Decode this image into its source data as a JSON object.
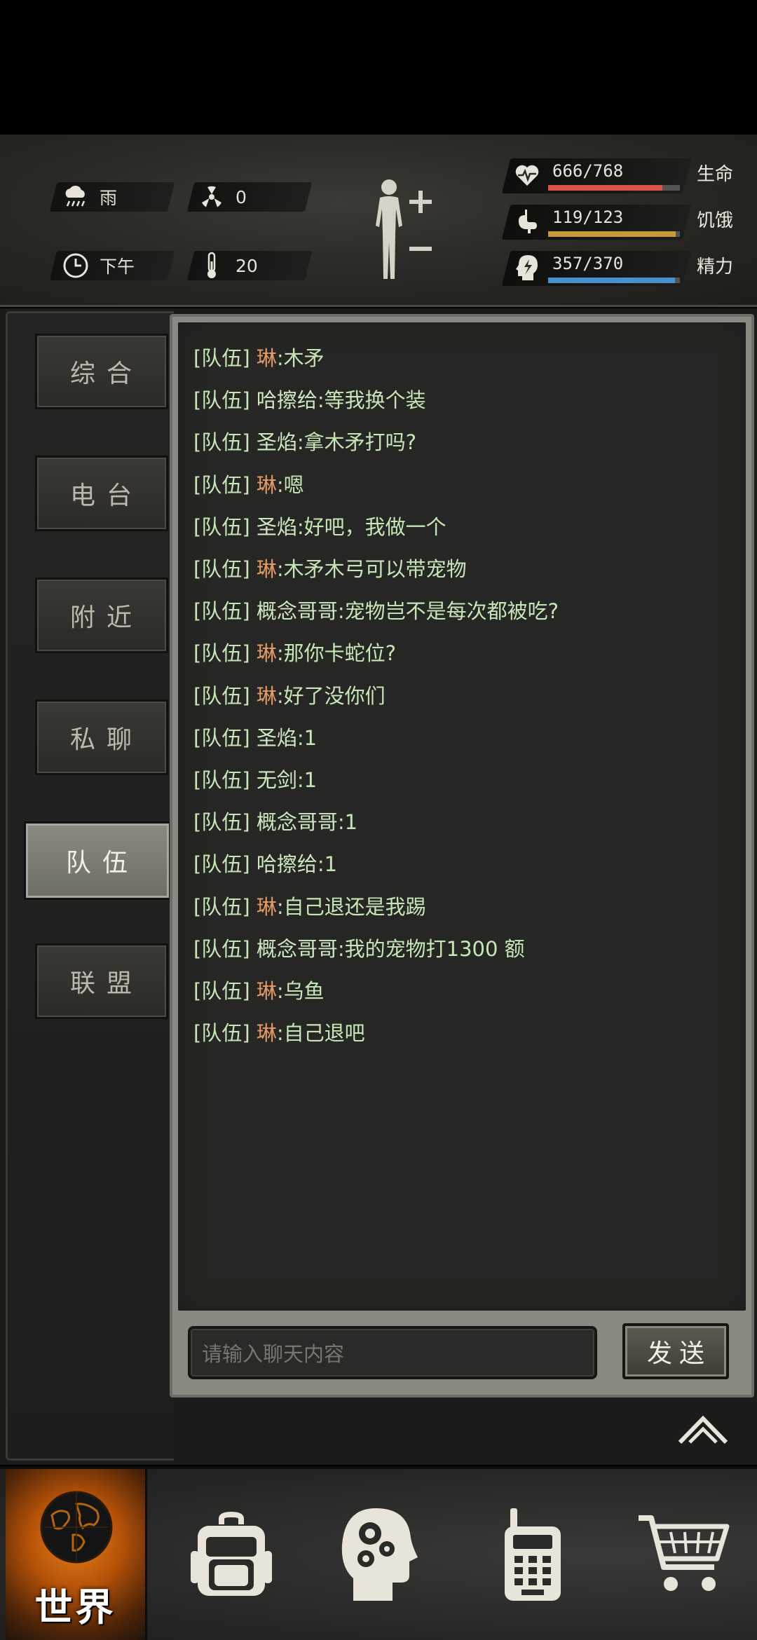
{
  "status": {
    "weather": {
      "icon": "rain-cloud-icon",
      "label": "雨"
    },
    "radiation": {
      "icon": "radiation-icon",
      "value": "0"
    },
    "time": {
      "icon": "clock-icon",
      "label": "下午"
    },
    "temperature": {
      "icon": "thermometer-icon",
      "value": "20"
    },
    "body_button": {
      "icon": "body-figure-icon"
    },
    "stats": [
      {
        "key": "health",
        "icon": "heart-pulse-icon",
        "value": "666/768",
        "label": "生命",
        "fraction": 0.867,
        "color": "#d9544a"
      },
      {
        "key": "hunger",
        "icon": "stomach-icon",
        "value": "119/123",
        "label": "饥饿",
        "fraction": 0.967,
        "color": "#c7993e"
      },
      {
        "key": "energy",
        "icon": "head-lightning-icon",
        "value": "357/370",
        "label": "精力",
        "fraction": 0.965,
        "color": "#4c8fcf"
      }
    ]
  },
  "tabs": [
    {
      "label": "综合",
      "active": false
    },
    {
      "label": "电台",
      "active": false
    },
    {
      "label": "附近",
      "active": false
    },
    {
      "label": "私聊",
      "active": false
    },
    {
      "label": "队伍",
      "active": true
    },
    {
      "label": "联盟",
      "active": false
    }
  ],
  "chat": {
    "messages": [
      {
        "channel": "[队伍]",
        "name": "琳",
        "text": ":木矛",
        "highlight": true
      },
      {
        "channel": "[队伍]",
        "name": "哈擦给",
        "text": ":等我换个装",
        "highlight": false
      },
      {
        "channel": "[队伍]",
        "name": "圣焰",
        "text": ":拿木矛打吗?",
        "highlight": false
      },
      {
        "channel": "[队伍]",
        "name": "琳",
        "text": ":嗯",
        "highlight": true
      },
      {
        "channel": "[队伍]",
        "name": "圣焰",
        "text": ":好吧，我做一个",
        "highlight": false
      },
      {
        "channel": "[队伍]",
        "name": "琳",
        "text": ":木矛木弓可以带宠物",
        "highlight": true
      },
      {
        "channel": "[队伍]",
        "name": "概念哥哥",
        "text": ":宠物岂不是每次都被吃?",
        "highlight": false
      },
      {
        "channel": "[队伍]",
        "name": "琳",
        "text": ":那你卡蛇位?",
        "highlight": true
      },
      {
        "channel": "[队伍]",
        "name": "琳",
        "text": ":好了没你们",
        "highlight": true
      },
      {
        "channel": "[队伍]",
        "name": "圣焰",
        "text": ":1",
        "highlight": false
      },
      {
        "channel": "[队伍]",
        "name": "无剑",
        "text": ":1",
        "highlight": false
      },
      {
        "channel": "[队伍]",
        "name": "概念哥哥",
        "text": ":1",
        "highlight": false
      },
      {
        "channel": "[队伍]",
        "name": "哈擦给",
        "text": ":1",
        "highlight": false
      },
      {
        "channel": "[队伍]",
        "name": "琳",
        "text": ":自己退还是我踢",
        "highlight": true
      },
      {
        "channel": "[队伍]",
        "name": "概念哥哥",
        "text": ":我的宠物打1300 额",
        "highlight": false
      },
      {
        "channel": "[队伍]",
        "name": "琳",
        "text": ":乌鱼",
        "highlight": true
      },
      {
        "channel": "[队伍]",
        "name": "琳",
        "text": ":自己退吧",
        "highlight": true
      }
    ],
    "input_placeholder": "请输入聊天内容",
    "send_label": "发送"
  },
  "bottom_nav": [
    {
      "key": "world",
      "label": "世界",
      "icon": "globe-icon",
      "active": true
    },
    {
      "key": "backpack",
      "icon": "backpack-icon",
      "active": false
    },
    {
      "key": "skills",
      "icon": "head-gears-icon",
      "active": false
    },
    {
      "key": "radio",
      "icon": "walkie-talkie-icon",
      "active": false
    },
    {
      "key": "shop",
      "icon": "shopping-cart-icon",
      "active": false
    }
  ]
}
